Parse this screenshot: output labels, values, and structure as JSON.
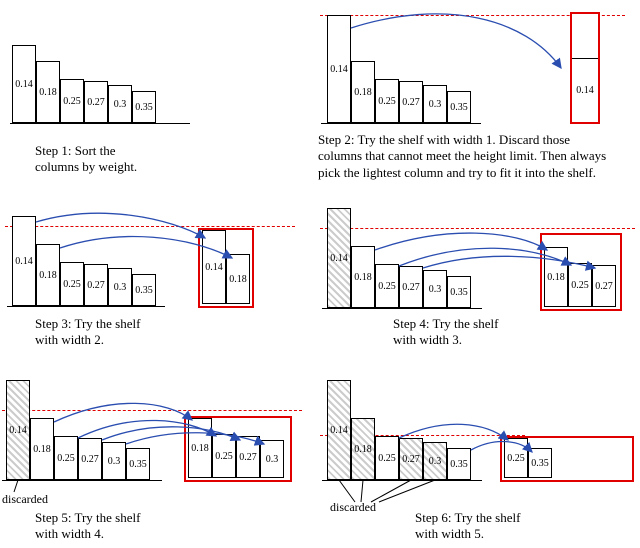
{
  "weights": {
    "c1": "0.14",
    "c2": "0.18",
    "c3": "0.25",
    "c4": "0.27",
    "c5": "0.3",
    "c6": "0.35"
  },
  "captions": {
    "s1": "Step 1: Sort the\ncolumns by weight.",
    "s2": "Step 2: Try the shelf with width 1. Discard those\ncolumns that cannot meet the height limit. Then always\npick the lightest column and try to fit it into the shelf.",
    "s3": "Step 3: Try the shelf\nwith width 2.",
    "s4": "Step 4: Try the shelf\nwith width 3.",
    "s5": "Step 5: Try the shelf\nwith width 4.",
    "s6": "Step 6: Try the shelf\nwith width 5."
  },
  "discarded_label": "discarded"
}
